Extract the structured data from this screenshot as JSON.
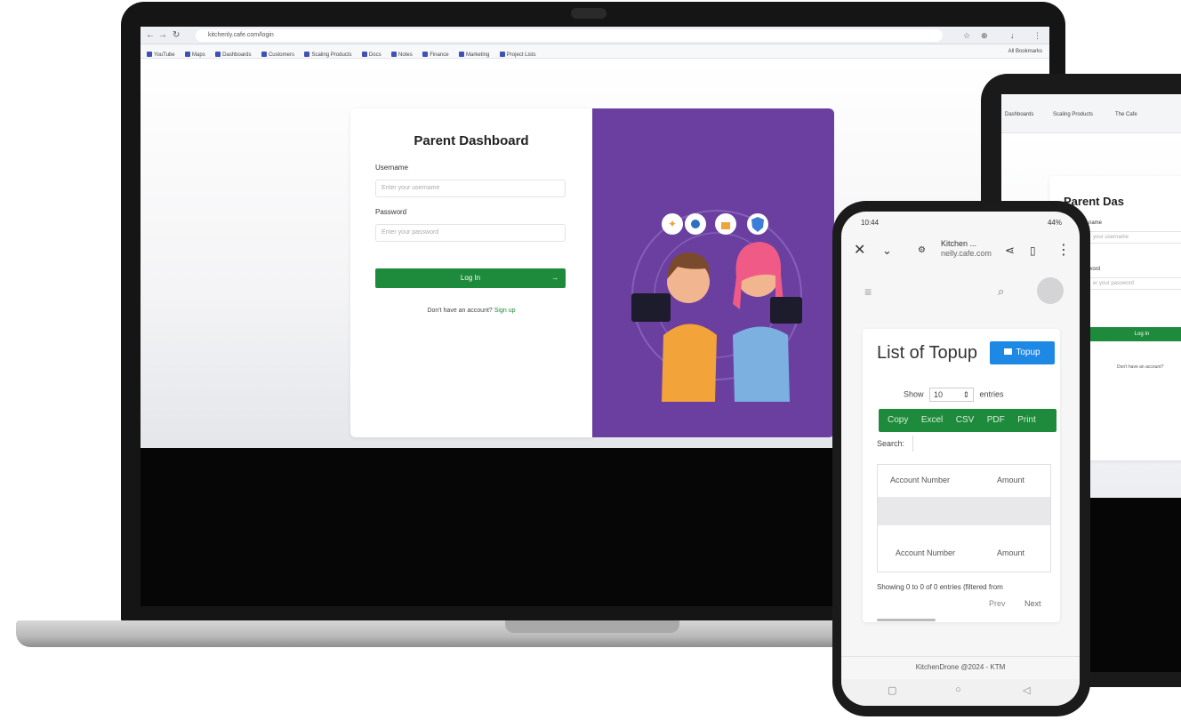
{
  "laptop": {
    "browser": {
      "url": "kitchenly.cafe.com/login",
      "bookmarks": [
        "YouTube",
        "Maps",
        "Dashboards",
        "Customers",
        "Scaling Products",
        "Docs",
        "Notes",
        "Finance",
        "Marketing",
        "Project Lists"
      ],
      "bookmark_right": "All Bookmarks"
    },
    "login": {
      "title": "Parent Dashboard",
      "username_label": "Username",
      "username_placeholder": "Enter your username",
      "password_label": "Password",
      "password_placeholder": "Enter your password",
      "login_button": "Log In",
      "login_arrow": "→",
      "signup_prompt": "Don't have an account?",
      "signup_link": "Sign up"
    },
    "colors": {
      "accent_green": "#1e8a3b",
      "illustration_purple": "#6b3fa0"
    }
  },
  "tablet": {
    "bookmarks": [
      "Dashboards",
      "Scaling Products",
      "The Cafe"
    ],
    "title": "Parent Das",
    "username_label": "name",
    "username_placeholder": "your username",
    "password_label": "word",
    "password_placeholder": "er your password",
    "login_button": "Log In",
    "signup_prompt": "Don't have an account?"
  },
  "phone": {
    "status_left": "10:44",
    "status_right": "44%",
    "site_name": "Kitchen ...",
    "site_url": "nelly.cafe.com",
    "list_title": "List of Topup",
    "topup_button": "Topup",
    "show_label": "Show",
    "show_value": "10",
    "entries_label": "entries",
    "export_buttons": [
      "Copy",
      "Excel",
      "CSV",
      "PDF",
      "Print"
    ],
    "search_label": "Search:",
    "table_headers": [
      "Account Number",
      "Amount"
    ],
    "table_footers": [
      "Account Number",
      "Amount"
    ],
    "info_text": "Showing 0 to 0 of 0 entries (filtered from",
    "prev_label": "Prev",
    "next_label": "Next",
    "footer_text": "KitchenDrone @2024 - KTM"
  }
}
